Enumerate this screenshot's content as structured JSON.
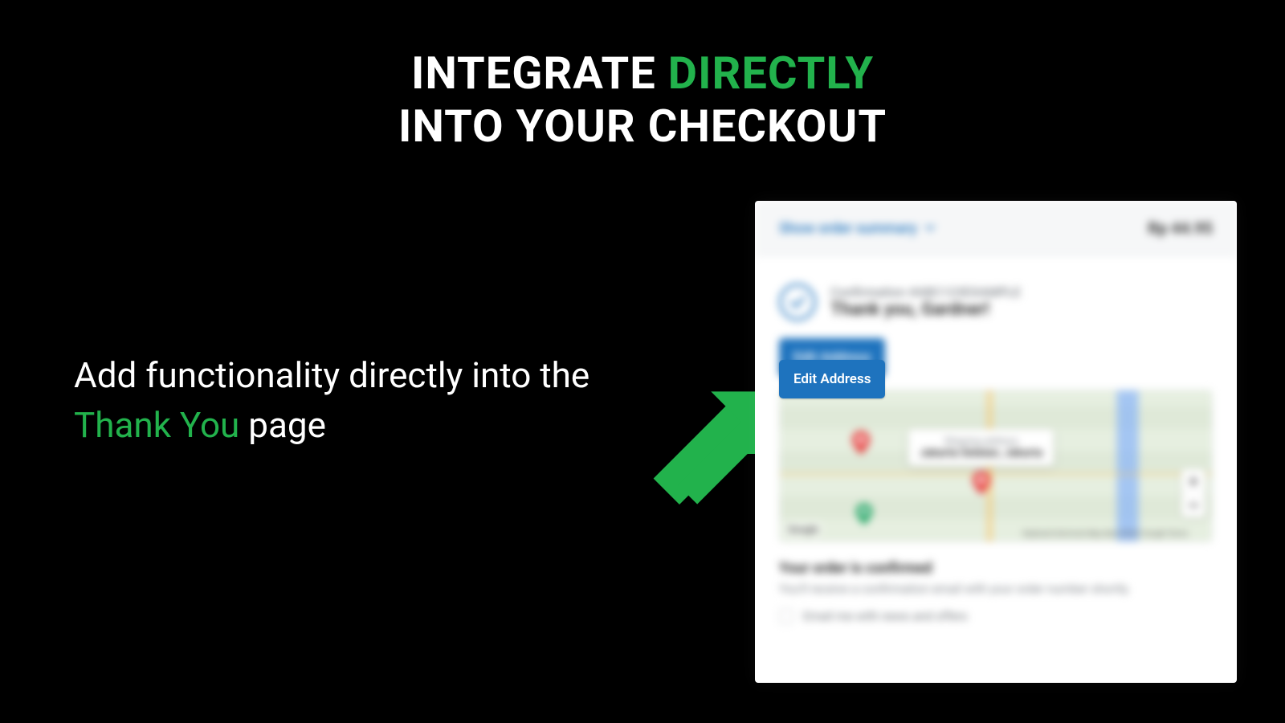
{
  "colors": {
    "accent": "#22b24c",
    "link_blue": "#1e73be",
    "black": "#000000",
    "white": "#ffffff"
  },
  "heading": {
    "p1": "INTEGRATE ",
    "accent": "DIRECTLY",
    "p2": "INTO YOUR CHECKOUT"
  },
  "subhead": {
    "p1": "Add functionality directly into the ",
    "accent": "Thank You",
    "p2": " page"
  },
  "checkout": {
    "summary_label": "Show order summary",
    "total": "Rp 44.95",
    "confirmation_label": "Confirmation #ABC123EXAMPLE",
    "thank_you": "Thank you, Gardner!",
    "edit_button": "Edit Address",
    "map": {
      "bubble_title": "Shipping address",
      "bubble_value": "Jakarta Selatan, Jakarta",
      "google_logo": "Google",
      "attribution": "Keyboard shortcuts   Map data ©2022 Google   Terms",
      "zoom_in": "+",
      "zoom_out": "−"
    },
    "order_confirmed_title": "Your order is confirmed",
    "order_confirmed_sub": "You'll receive a confirmation email with your order number shortly.",
    "email_opt_in": "Email me with news and offers"
  },
  "icons": {
    "arrow": "arrow-up-right-icon",
    "check": "check-circle-icon",
    "chevron": "chevron-down-icon",
    "pin": "map-pin-icon"
  }
}
